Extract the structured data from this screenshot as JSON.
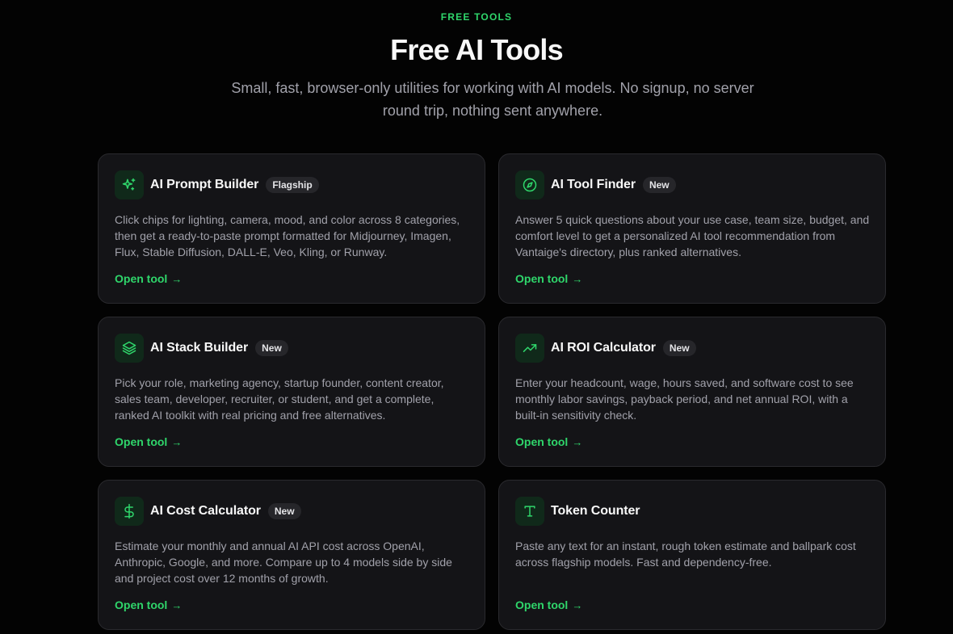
{
  "hero": {
    "eyebrow": "FREE TOOLS",
    "title": "Free AI Tools",
    "subtitle": "Small, fast, browser-only utilities for working with AI models. No signup, no server round trip, nothing sent anywhere."
  },
  "accent_color": "#2fd66b",
  "cards": [
    {
      "icon": "sparkles-icon",
      "title": "AI Prompt Builder",
      "badge": "Flagship",
      "description": "Click chips for lighting, camera, mood, and color across 8 categories, then get a ready-to-paste prompt formatted for Midjourney, Imagen, Flux, Stable Diffusion, DALL-E, Veo, Kling, or Runway.",
      "link": "Open tool",
      "arrow": "→"
    },
    {
      "icon": "compass-icon",
      "title": "AI Tool Finder",
      "badge": "New",
      "description": "Answer 5 quick questions about your use case, team size, budget, and comfort level to get a personalized AI tool recommendation from Vantaige's directory, plus ranked alternatives.",
      "link": "Open tool",
      "arrow": "→"
    },
    {
      "icon": "layers-icon",
      "title": "AI Stack Builder",
      "badge": "New",
      "description": "Pick your role, marketing agency, startup founder, content creator, sales team, developer, recruiter, or student, and get a complete, ranked AI toolkit with real pricing and free alternatives.",
      "link": "Open tool",
      "arrow": "→"
    },
    {
      "icon": "trending-up-icon",
      "title": "AI ROI Calculator",
      "badge": "New",
      "description": "Enter your headcount, wage, hours saved, and software cost to see monthly labor savings, payback period, and net annual ROI, with a built-in sensitivity check.",
      "link": "Open tool",
      "arrow": "→"
    },
    {
      "icon": "dollar-icon",
      "title": "AI Cost Calculator",
      "badge": "New",
      "description": "Estimate your monthly and annual AI API cost across OpenAI, Anthropic, Google, and more. Compare up to 4 models side by side and project cost over 12 months of growth.",
      "link": "Open tool",
      "arrow": "→"
    },
    {
      "icon": "type-icon",
      "title": "Token Counter",
      "badge": "",
      "description": "Paste any text for an instant, rough token estimate and ballpark cost across flagship models. Fast and dependency-free.",
      "link": "Open tool",
      "arrow": "→"
    }
  ]
}
